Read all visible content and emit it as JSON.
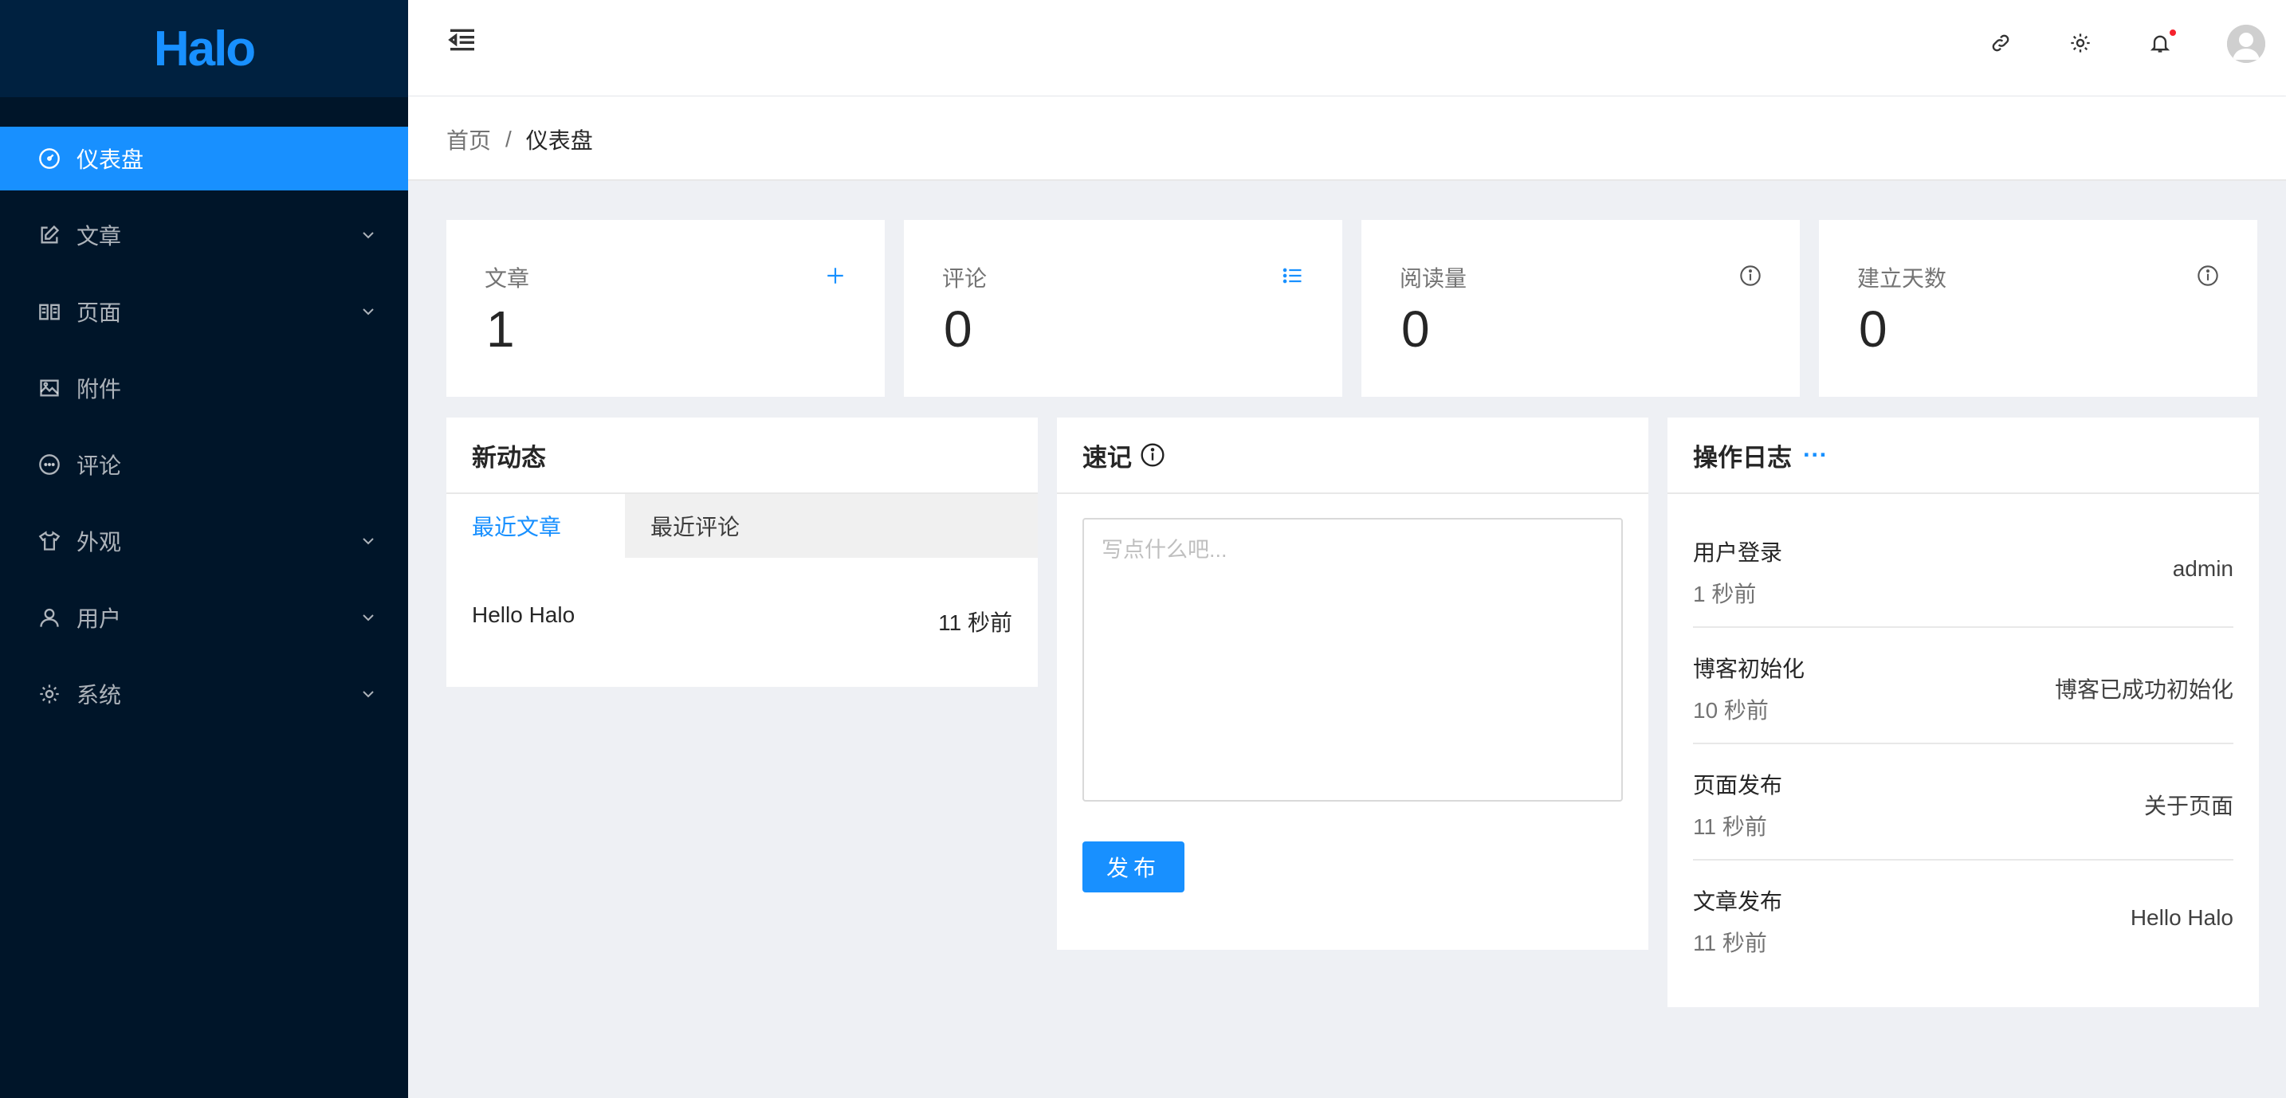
{
  "app": {
    "logo": "Halo"
  },
  "sidebar": {
    "items": [
      {
        "label": "仪表盘",
        "icon": "dashboard-icon",
        "expandable": false,
        "active": true
      },
      {
        "label": "文章",
        "icon": "edit-icon",
        "expandable": true
      },
      {
        "label": "页面",
        "icon": "book-icon",
        "expandable": true
      },
      {
        "label": "附件",
        "icon": "image-icon",
        "expandable": false
      },
      {
        "label": "评论",
        "icon": "message-icon",
        "expandable": false
      },
      {
        "label": "外观",
        "icon": "shirt-icon",
        "expandable": true
      },
      {
        "label": "用户",
        "icon": "user-icon",
        "expandable": true
      },
      {
        "label": "系统",
        "icon": "gear-icon",
        "expandable": true
      }
    ]
  },
  "header": {
    "icons": [
      "menu-fold-icon",
      "link-icon",
      "settings-icon",
      "bell-icon",
      "avatar"
    ]
  },
  "breadcrumb": {
    "home": "首页",
    "separator": "/",
    "current": "仪表盘"
  },
  "stats": [
    {
      "label": "文章",
      "value": "1",
      "icon": "plus-icon"
    },
    {
      "label": "评论",
      "value": "0",
      "icon": "list-icon"
    },
    {
      "label": "阅读量",
      "value": "0",
      "icon": "info-icon"
    },
    {
      "label": "建立天数",
      "value": "0",
      "icon": "info-icon"
    }
  ],
  "activity": {
    "title": "新动态",
    "tabs": [
      "最近文章",
      "最近评论"
    ],
    "items": [
      {
        "title": "Hello Halo",
        "time": "11 秒前"
      }
    ]
  },
  "memo": {
    "title": "速记",
    "placeholder": "写点什么吧...",
    "button": "发布"
  },
  "logs": {
    "title": "操作日志",
    "more": "···",
    "items": [
      {
        "type": "用户登录",
        "time": "1 秒前",
        "content": "admin"
      },
      {
        "type": "博客初始化",
        "time": "10 秒前",
        "content": "博客已成功初始化"
      },
      {
        "type": "页面发布",
        "time": "11 秒前",
        "content": "关于页面"
      },
      {
        "type": "文章发布",
        "time": "11 秒前",
        "content": "Hello Halo"
      }
    ]
  },
  "colors": {
    "primary": "#1890ff",
    "sidebar": "#001529",
    "logo_bg": "#002140",
    "badge": "#f5222d"
  }
}
